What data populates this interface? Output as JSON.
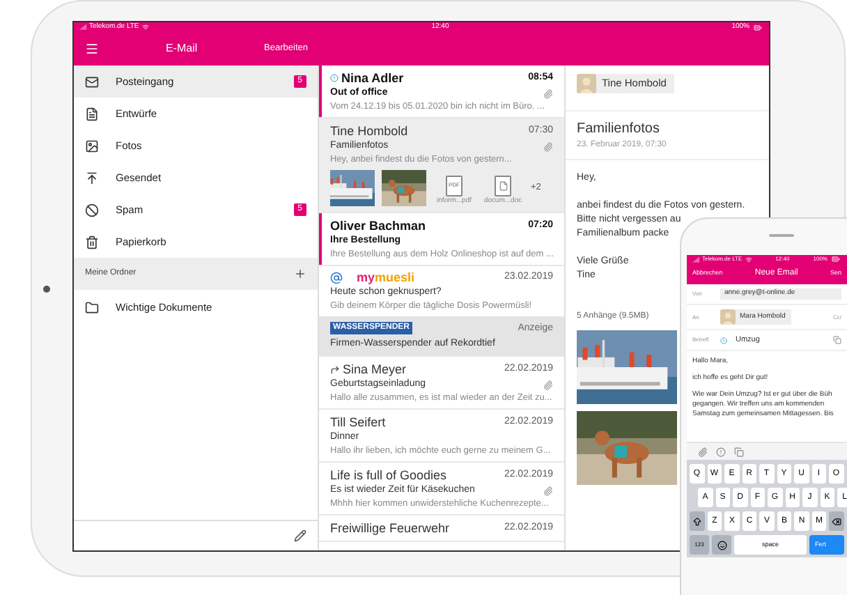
{
  "tablet": {
    "status_bar": {
      "carrier": "Telekom.de  LTE",
      "time": "12:40",
      "battery": "100%"
    },
    "sidebar": {
      "title": "E-Mail",
      "edit": "Bearbeiten",
      "items": [
        {
          "label": "Posteingang",
          "badge": "5",
          "selected": true
        },
        {
          "label": "Entwürfe",
          "selected": false
        },
        {
          "label": "Fotos",
          "selected": false
        },
        {
          "label": "Gesendet",
          "selected": false
        },
        {
          "label": "Spam",
          "badge": "5",
          "selected": false
        },
        {
          "label": "Papierkorb",
          "selected": false
        }
      ],
      "section": "Meine Ordner",
      "folders": [
        {
          "label": "Wichtige Dokumente",
          "selected": false
        }
      ]
    },
    "messages": [
      {
        "kind": "mail",
        "sender": "Nina Adler",
        "important": true,
        "replied": false,
        "time": "08:54",
        "subject": "Out of office",
        "preview": "Vom 24.12.19 bis 05.01.2020 bin ich nicht im Büro. ...",
        "unread": true,
        "selected": false,
        "attachment": true
      },
      {
        "kind": "mail",
        "sender": "Tine Hombold",
        "important": false,
        "replied": false,
        "time": "07:30",
        "subject": "Familienfotos",
        "preview": "Hey, anbei findest du die Fotos von gestern...",
        "unread": false,
        "selected": true,
        "attachment": true,
        "attachments": [
          {
            "kind": "picture"
          },
          {
            "kind": "picture"
          },
          {
            "kind": "file",
            "type": "PDF",
            "name": "inform...pdf"
          },
          {
            "kind": "file",
            "name": "docum...doc"
          }
        ],
        "more": "+2"
      },
      {
        "kind": "mail",
        "sender": "Oliver Bachman",
        "important": false,
        "replied": false,
        "time": "07:20",
        "subject": "Ihre Bestellung",
        "preview": "Ihre Bestellung aus dem Holz Onlineshop ist auf dem ...",
        "unread": true,
        "selected": false,
        "attachment": false
      },
      {
        "kind": "ad_logo",
        "logo_a": "my",
        "logo_b": "muesli",
        "time": "23.02.2019",
        "subject": "Heute schon geknuspert?",
        "preview": "Gib deinem Körper die tägliche Dosis Powermüsli!"
      },
      {
        "kind": "ad_banner",
        "logo": "WASSERSPENDER",
        "label": "Anzeige",
        "subject": "Firmen-Wasserspender auf Rekordtief"
      },
      {
        "kind": "mail",
        "sender": "Sina Meyer",
        "important": false,
        "replied": true,
        "time": "22.02.2019",
        "subject": "Geburtstagseinladung",
        "preview": "Hallo alle zusammen, es ist mal wieder an der Zeit zu...",
        "unread": false,
        "selected": false,
        "attachment": true
      },
      {
        "kind": "mail",
        "sender": "Till Seifert",
        "important": false,
        "replied": false,
        "time": "22.02.2019",
        "subject": "Dinner",
        "preview": "Hallo ihr lieben, ich möchte euch gerne zu meinem G...",
        "unread": false,
        "selected": false,
        "attachment": false
      },
      {
        "kind": "mail",
        "sender": "Life is full of Goodies",
        "important": false,
        "replied": false,
        "time": "22.02.2019",
        "subject": "Es ist wieder Zeit für Käsekuchen",
        "preview": "Mhhh hier kommen unwiderstehliche Kuchenrezepte...",
        "unread": false,
        "selected": false,
        "attachment": true
      },
      {
        "kind": "mail",
        "sender": "Freiwillige Feuerwehr",
        "important": false,
        "replied": false,
        "time": "22.02.2019",
        "unread": false,
        "selected": false
      }
    ],
    "reader": {
      "sender": "Tine Hombold",
      "subject": "Familienfotos",
      "date": "23. Februar 2019, 07:30",
      "body": [
        "Hey,",
        "anbei findest du die Fotos von gestern.",
        "Bitte nicht vergessen au",
        "Familienalbum packe"
      ],
      "signature": [
        "Viele Grüße",
        "Tine"
      ],
      "attachments_title": "5 Anhänge (9.5MB)",
      "pictures": [
        {
          "kind": "picture"
        },
        {
          "kind": "picture"
        }
      ]
    }
  },
  "phone": {
    "status_bar": {
      "carrier": "Telekom.de  LTE",
      "time": "12:40",
      "battery": "100%"
    },
    "cancel": "Abbrechen",
    "title": "Neue Email",
    "send": "Sen",
    "from_label": "Von",
    "from": "anne.grey@t-online.de",
    "to_label": "An",
    "to": "Mara Hombold",
    "cc": "Cc/",
    "subject_label": "Betreff",
    "important": true,
    "subject": "Umzug",
    "body": [
      "Hallo Mara,",
      "ich hoffe es geht Dir gut!",
      "Wie war Dein Umzug? Ist er gut über die Büh",
      "gegangen. Wir treffen uns am kommenden",
      "Samstag zum gemeinsamen Mittagessen. Bis"
    ],
    "keyboard": [
      [
        "Q",
        "W",
        "E",
        "R",
        "T",
        "Y",
        "U",
        "I",
        "O"
      ],
      [
        "A",
        "S",
        "D",
        "F",
        "G",
        "H",
        "J",
        "K",
        "L"
      ],
      [
        "Z",
        "X",
        "C",
        "V",
        "B",
        "N",
        "M"
      ]
    ],
    "numbers": "123",
    "space": "space",
    "done": "Fert"
  }
}
